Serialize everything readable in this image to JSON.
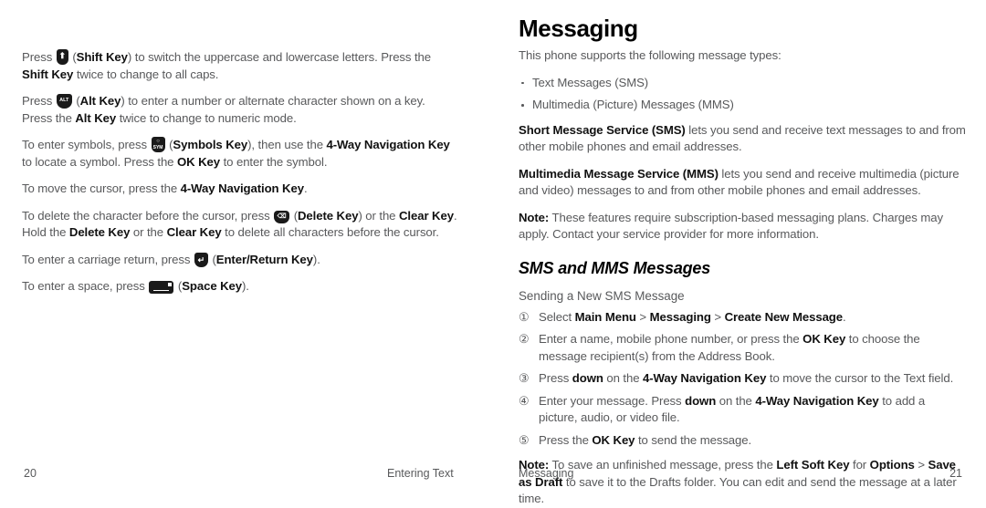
{
  "document": {
    "type": "phone-user-manual-spread"
  },
  "left_page": {
    "paragraphs": [
      {
        "id": "shift-key-para",
        "runs": [
          {
            "t": "Press ",
            "style": "normal"
          },
          {
            "t": "shift-key-icon",
            "style": "icon",
            "icon": "shift-key"
          },
          {
            "t": " (",
            "style": "normal"
          },
          {
            "t": "Shift Key",
            "style": "bold"
          },
          {
            "t": ") to switch the uppercase and lowercase letters. Press the ",
            "style": "normal"
          },
          {
            "t": "Shift Key",
            "style": "bold"
          },
          {
            "t": " twice to change to all caps.",
            "style": "normal"
          }
        ]
      },
      {
        "id": "alt-key-para",
        "runs": [
          {
            "t": "Press ",
            "style": "normal"
          },
          {
            "t": "alt-key-icon",
            "style": "icon",
            "icon": "alt-key"
          },
          {
            "t": " (",
            "style": "normal"
          },
          {
            "t": "Alt Key",
            "style": "bold"
          },
          {
            "t": ") to enter a number or alternate character shown on a key. Press the ",
            "style": "normal"
          },
          {
            "t": "Alt Key",
            "style": "bold"
          },
          {
            "t": " twice to change to numeric mode.",
            "style": "normal"
          }
        ]
      },
      {
        "id": "symbols-key-para",
        "runs": [
          {
            "t": "To enter symbols, press ",
            "style": "normal"
          },
          {
            "t": "symbols-key-icon",
            "style": "icon",
            "icon": "sym-key"
          },
          {
            "t": " (",
            "style": "normal"
          },
          {
            "t": "Symbols Key",
            "style": "bold"
          },
          {
            "t": "), then use the ",
            "style": "normal"
          },
          {
            "t": "4-Way Navigation Key",
            "style": "bold"
          },
          {
            "t": " to locate a symbol. Press the ",
            "style": "normal"
          },
          {
            "t": "OK Key",
            "style": "bold"
          },
          {
            "t": " to enter the symbol.",
            "style": "normal"
          }
        ]
      },
      {
        "id": "move-cursor-para",
        "runs": [
          {
            "t": "To move the cursor, press the ",
            "style": "normal"
          },
          {
            "t": "4-Way Navigation Key",
            "style": "bold"
          },
          {
            "t": ".",
            "style": "normal"
          }
        ]
      },
      {
        "id": "delete-key-para",
        "runs": [
          {
            "t": "To delete the character before the cursor, press ",
            "style": "normal"
          },
          {
            "t": "delete-key-icon",
            "style": "icon",
            "icon": "del-key"
          },
          {
            "t": " (",
            "style": "normal"
          },
          {
            "t": "Delete Key",
            "style": "bold"
          },
          {
            "t": ") or the ",
            "style": "normal"
          },
          {
            "t": "Clear Key",
            "style": "bold"
          },
          {
            "t": ". Hold the ",
            "style": "normal"
          },
          {
            "t": "Delete Key",
            "style": "bold"
          },
          {
            "t": " or the ",
            "style": "normal"
          },
          {
            "t": "Clear Key",
            "style": "bold"
          },
          {
            "t": " to delete all characters before the cursor.",
            "style": "normal"
          }
        ]
      },
      {
        "id": "enter-key-para",
        "runs": [
          {
            "t": "To enter a carriage return, press ",
            "style": "normal"
          },
          {
            "t": "enter-return-key-icon",
            "style": "icon",
            "icon": "enter-key"
          },
          {
            "t": " (",
            "style": "normal"
          },
          {
            "t": "Enter/Return Key",
            "style": "bold"
          },
          {
            "t": ").",
            "style": "normal"
          }
        ]
      },
      {
        "id": "space-key-para",
        "runs": [
          {
            "t": "To enter a space, press ",
            "style": "normal"
          },
          {
            "t": "space-key-icon",
            "style": "icon",
            "icon": "space-key"
          },
          {
            "t": " (",
            "style": "normal"
          },
          {
            "t": "Space Key",
            "style": "bold"
          },
          {
            "t": ").",
            "style": "normal"
          }
        ]
      }
    ]
  },
  "right_page": {
    "heading": "Messaging",
    "intro": "This phone supports the following message types:",
    "bullets": [
      "Text Messages (SMS)",
      "Multimedia (Picture) Messages (MMS)"
    ],
    "paragraphs": [
      {
        "id": "sms-definition-para",
        "runs": [
          {
            "t": "Short Message Service (SMS)",
            "style": "bold"
          },
          {
            "t": " lets you send and receive text messages to and from other mobile phones and email addresses.",
            "style": "normal"
          }
        ]
      },
      {
        "id": "mms-definition-para",
        "runs": [
          {
            "t": "Multimedia Message Service (MMS)",
            "style": "bold"
          },
          {
            "t": " lets you send and receive multimedia (picture and video) messages to and from other mobile phones and email addresses.",
            "style": "normal"
          }
        ]
      },
      {
        "id": "subscription-note-para",
        "runs": [
          {
            "t": "Note:",
            "style": "bold"
          },
          {
            "t": " These features require subscription-based messaging plans. Charges may apply. Contact your service provider for more information.",
            "style": "normal"
          }
        ]
      }
    ],
    "subheading": "SMS and MMS Messages",
    "procedure_title": "Sending a New SMS Message",
    "steps": [
      {
        "marker": "①",
        "runs": [
          {
            "t": "Select ",
            "style": "normal"
          },
          {
            "t": "Main Menu",
            "style": "bold"
          },
          {
            "t": " > ",
            "style": "normal"
          },
          {
            "t": "Messaging",
            "style": "bold"
          },
          {
            "t": " > ",
            "style": "normal"
          },
          {
            "t": "Create New Message",
            "style": "bold"
          },
          {
            "t": ".",
            "style": "normal"
          }
        ]
      },
      {
        "marker": "②",
        "runs": [
          {
            "t": "Enter a name, mobile phone number, or press the ",
            "style": "normal"
          },
          {
            "t": "OK Key",
            "style": "bold"
          },
          {
            "t": " to choose the message recipient(s) from the Address Book.",
            "style": "normal"
          }
        ]
      },
      {
        "marker": "③",
        "runs": [
          {
            "t": "Press ",
            "style": "normal"
          },
          {
            "t": "down",
            "style": "bold"
          },
          {
            "t": " on the ",
            "style": "normal"
          },
          {
            "t": "4-Way Navigation Key",
            "style": "bold"
          },
          {
            "t": " to move the cursor to the Text field.",
            "style": "normal"
          }
        ]
      },
      {
        "marker": "④",
        "runs": [
          {
            "t": "Enter your message. Press ",
            "style": "normal"
          },
          {
            "t": "down",
            "style": "bold"
          },
          {
            "t": " on the ",
            "style": "normal"
          },
          {
            "t": "4-Way Navigation Key",
            "style": "bold"
          },
          {
            "t": " to add a picture, audio, or video file.",
            "style": "normal"
          }
        ]
      },
      {
        "marker": "⑤",
        "runs": [
          {
            "t": "Press the ",
            "style": "normal"
          },
          {
            "t": "OK Key",
            "style": "bold"
          },
          {
            "t": " to send the message.",
            "style": "normal"
          }
        ]
      }
    ],
    "draft_note": {
      "id": "draft-note-para",
      "runs": [
        {
          "t": "Note:",
          "style": "bold"
        },
        {
          "t": " To save an unfinished message, press the ",
          "style": "normal"
        },
        {
          "t": "Left Soft Key",
          "style": "bold"
        },
        {
          "t": " for ",
          "style": "normal"
        },
        {
          "t": "Options",
          "style": "bold"
        },
        {
          "t": " > ",
          "style": "normal"
        },
        {
          "t": "Save as Draft",
          "style": "bold"
        },
        {
          "t": " to save it to the Drafts folder. You can edit and send the message at a later time.",
          "style": "normal"
        }
      ]
    }
  },
  "footer": {
    "left_page_number": "20",
    "left_section": "Entering Text",
    "right_section": "Messaging",
    "right_page_number": "21"
  },
  "key_icons": {
    "shift-key": {
      "label": "⬆",
      "name": "shift-key-icon"
    },
    "alt-key": {
      "label": "ALT",
      "name": "alt-key-icon"
    },
    "sym-key": {
      "label": "SYM",
      "name": "symbols-key-icon"
    },
    "del-key": {
      "label": "⌫",
      "name": "delete-key-icon"
    },
    "enter-key": {
      "label": "↵",
      "name": "enter-return-key-icon"
    },
    "space-key": {
      "label": "",
      "name": "space-key-icon"
    }
  },
  "colors": {
    "body_text": "#58595b",
    "bold_text": "#111111",
    "heading": "#000000",
    "key_icon_bg": "#1a1a1a",
    "page_bg": "#ffffff"
  }
}
